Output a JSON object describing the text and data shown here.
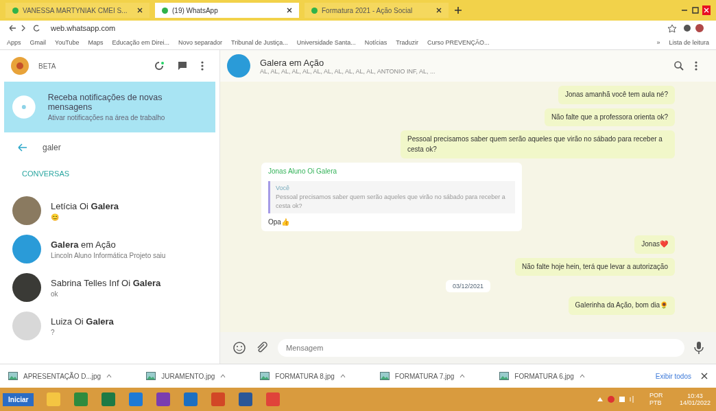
{
  "browser": {
    "tabs": [
      {
        "title": "VANESSA MARTYNIAK CMEI S...",
        "selected": false
      },
      {
        "title": "(19) WhatsApp",
        "selected": true
      },
      {
        "title": "Formatura 2021 - Ação Social",
        "selected": false
      }
    ],
    "address": "web.whatsapp.com",
    "bookmarks": [
      "Apps",
      "Gmail",
      "YouTube",
      "Maps",
      "Educação em Direi...",
      "Novo separador",
      "Tribunal de Justiça...",
      "Universidade Santa...",
      "Notícias",
      "Traduzir",
      "Curso PREVENÇÃO..."
    ],
    "bookmarks_overflow": "»",
    "reading_list": "Lista de leitura"
  },
  "sidebar": {
    "profile_name": "BETA",
    "notice": {
      "title": "Receba notificações de novas mensagens",
      "subtitle": "Ativar notificações na área de trabalho"
    },
    "search": {
      "value": "galer"
    },
    "section_title": "CONVERSAS",
    "chats": [
      {
        "name": "Letícia Oi **Galera**",
        "preview": "😊"
      },
      {
        "name": "**Galera** em Ação",
        "preview": "Lincoln Aluno Informática Projeto saiu"
      },
      {
        "name": "Sabrina Telles Inf Oi **Galera**",
        "preview": "ok"
      },
      {
        "name": "Luiza Oi **Galera**",
        "preview": "?"
      }
    ]
  },
  "chat": {
    "title": "Galera em Ação",
    "participants": "AL, AL, AL, AL, AL, AL, AL, AL, AL, AL, AL, ANTONIO INF, AL, ...",
    "messages": [
      {
        "kind": "out",
        "text": "Jonas amanhã você tem aula né?"
      },
      {
        "kind": "out",
        "text": "Não falte que a professora orienta ok?"
      },
      {
        "kind": "out",
        "text": "Pessoal precisamos saber quem serão aqueles que virão no sábado para receber a cesta ok?"
      },
      {
        "kind": "in",
        "sender": "Jonas Aluno Oi Galera",
        "quote_author": "Você",
        "quote": "Pessoal precisamos saber quem serão aqueles que virão no sábado para receber a cesta ok?",
        "text": "Opa👍"
      },
      {
        "kind": "out",
        "text": "Jonas❤️"
      },
      {
        "kind": "out",
        "text": "Não falte hoje hein, terá que levar a autorização"
      },
      {
        "kind": "date",
        "text": "03/12/2021"
      },
      {
        "kind": "out",
        "text": "Galerinha da Ação, bom dia🌻"
      }
    ],
    "composer": {
      "placeholder": "Mensagem"
    }
  },
  "downloads": {
    "files": [
      "APRESENTAÇÃO D...jpg",
      "JURAMENTO.jpg",
      "FORMATURA 8.jpg",
      "FORMATURA 7.jpg",
      "FORMATURA 6.jpg"
    ],
    "show_all": "Exibir todos"
  },
  "taskbar": {
    "start": "Iniciar",
    "language": "POR PTB",
    "time": "10:43",
    "date": "14/01/2022"
  }
}
